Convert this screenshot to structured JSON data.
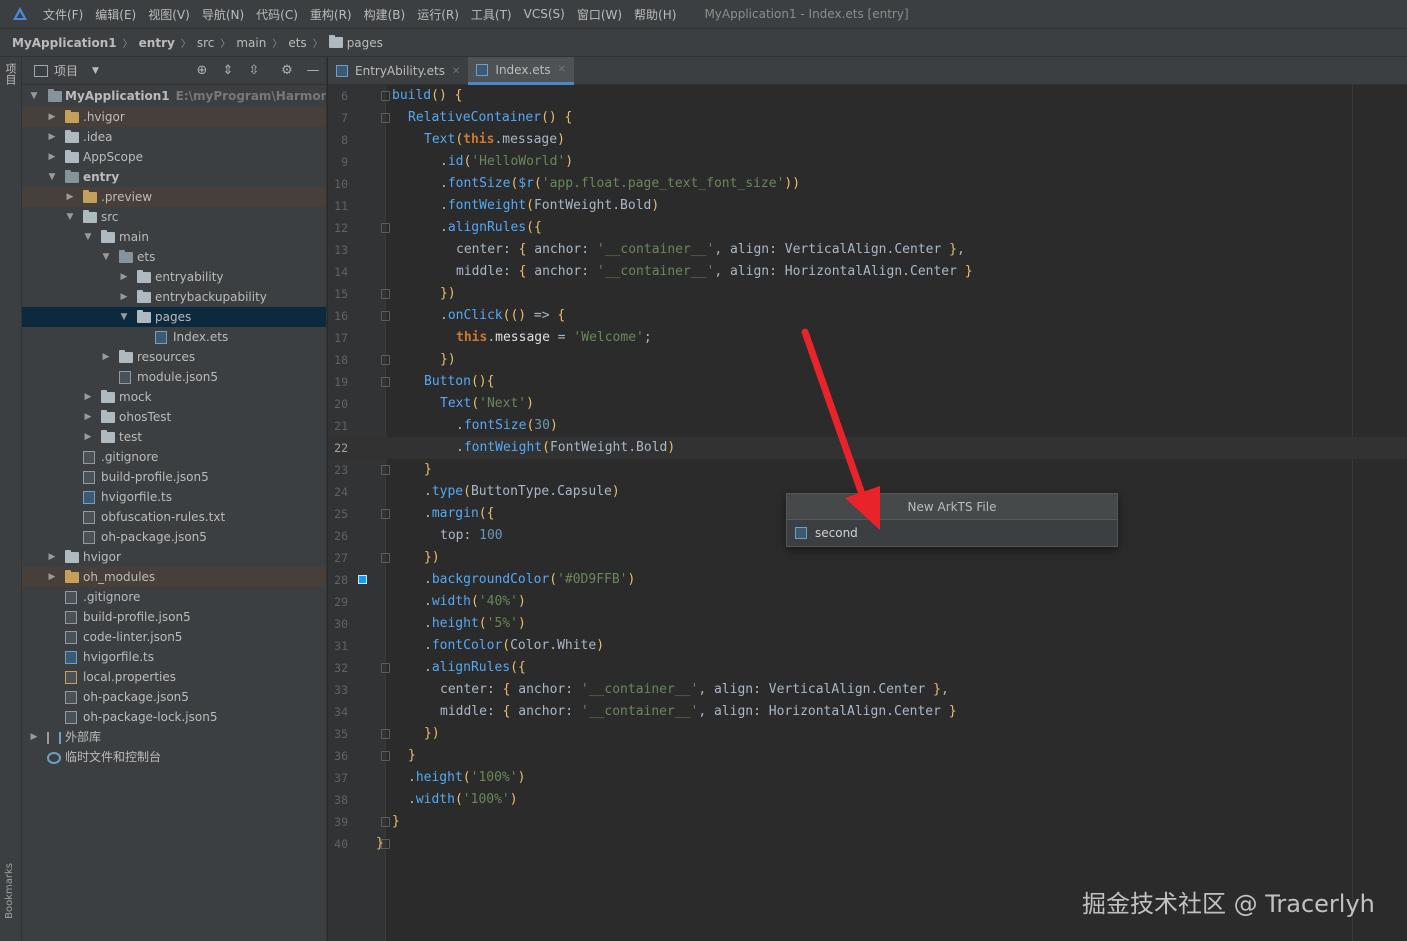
{
  "menubar": {
    "items": [
      "文件(F)",
      "编辑(E)",
      "视图(V)",
      "导航(N)",
      "代码(C)",
      "重构(R)",
      "构建(B)",
      "运行(R)",
      "工具(T)",
      "VCS(S)",
      "窗口(W)",
      "帮助(H)"
    ],
    "window_title": "MyApplication1 - Index.ets [entry]"
  },
  "breadcrumb": {
    "project": "MyApplication1",
    "module": "entry",
    "parts": [
      "src",
      "main",
      "ets"
    ],
    "current": "pages"
  },
  "left_strip": {
    "project_label": "项目",
    "bookmarks_label": "Bookmarks"
  },
  "project_panel": {
    "title": "项目",
    "root_label": "MyApplication1",
    "root_path": "E:\\myProgram\\HarmonyOS",
    "tree": [
      {
        "label": ".hvigor"
      },
      {
        "label": ".idea"
      },
      {
        "label": "AppScope"
      },
      {
        "label": "entry"
      },
      {
        "label": ".preview"
      },
      {
        "label": "src"
      },
      {
        "label": "main"
      },
      {
        "label": "ets"
      },
      {
        "label": "entryability"
      },
      {
        "label": "entrybackupability"
      },
      {
        "label": "pages"
      },
      {
        "label": "Index.ets"
      },
      {
        "label": "resources"
      },
      {
        "label": "module.json5"
      },
      {
        "label": "mock"
      },
      {
        "label": "ohosTest"
      },
      {
        "label": "test"
      },
      {
        "label": ".gitignore"
      },
      {
        "label": "build-profile.json5"
      },
      {
        "label": "hvigorfile.ts"
      },
      {
        "label": "obfuscation-rules.txt"
      },
      {
        "label": "oh-package.json5"
      },
      {
        "label": "hvigor"
      },
      {
        "label": "oh_modules"
      },
      {
        "label": ".gitignore"
      },
      {
        "label": "build-profile.json5"
      },
      {
        "label": "code-linter.json5"
      },
      {
        "label": "hvigorfile.ts"
      },
      {
        "label": "local.properties"
      },
      {
        "label": "oh-package.json5"
      },
      {
        "label": "oh-package-lock.json5"
      },
      {
        "label": "外部库"
      },
      {
        "label": "临时文件和控制台"
      }
    ]
  },
  "tabs": [
    {
      "label": "EntryAbility.ets",
      "active": false
    },
    {
      "label": "Index.ets",
      "active": true
    }
  ],
  "editor": {
    "lines": [
      {
        "n": "6",
        "text": "build() {"
      },
      {
        "n": "7",
        "text": "RelativeContainer() {"
      },
      {
        "n": "8",
        "text": "Text(this.message)"
      },
      {
        "n": "9",
        "text": ".id('HelloWorld')"
      },
      {
        "n": "10",
        "text": ".fontSize($r('app.float.page_text_font_size'))"
      },
      {
        "n": "11",
        "text": ".fontWeight(FontWeight.Bold)"
      },
      {
        "n": "12",
        "text": ".alignRules({"
      },
      {
        "n": "13",
        "text": "center: { anchor: '__container__', align: VerticalAlign.Center },"
      },
      {
        "n": "14",
        "text": "middle: { anchor: '__container__', align: HorizontalAlign.Center }"
      },
      {
        "n": "15",
        "text": "})"
      },
      {
        "n": "16",
        "text": ".onClick(() => {"
      },
      {
        "n": "17",
        "text": "this.message = 'Welcome';"
      },
      {
        "n": "18",
        "text": "})"
      },
      {
        "n": "19",
        "text": "Button(){"
      },
      {
        "n": "20",
        "text": "Text('Next')"
      },
      {
        "n": "21",
        "text": ".fontSize(30)"
      },
      {
        "n": "22",
        "text": ".fontWeight(FontWeight.Bold)"
      },
      {
        "n": "23",
        "text": "}"
      },
      {
        "n": "24",
        "text": ".type(ButtonType.Capsule)"
      },
      {
        "n": "25",
        "text": ".margin({"
      },
      {
        "n": "26",
        "text": "top: 100"
      },
      {
        "n": "27",
        "text": "})"
      },
      {
        "n": "28",
        "text": ".backgroundColor('#0D9FFB')"
      },
      {
        "n": "29",
        "text": ".width('40%')"
      },
      {
        "n": "30",
        "text": ".height('5%')"
      },
      {
        "n": "31",
        "text": ".fontColor(Color.White)"
      },
      {
        "n": "32",
        "text": ".alignRules({"
      },
      {
        "n": "33",
        "text": "center: { anchor: '__container__', align: VerticalAlign.Center },"
      },
      {
        "n": "34",
        "text": "middle: { anchor: '__container__', align: HorizontalAlign.Center }"
      },
      {
        "n": "35",
        "text": "})"
      },
      {
        "n": "36",
        "text": "}"
      },
      {
        "n": "37",
        "text": ".height('100%')"
      },
      {
        "n": "38",
        "text": ".width('100%')"
      },
      {
        "n": "39",
        "text": "}"
      },
      {
        "n": "40",
        "text": "}"
      }
    ],
    "current_line": "22"
  },
  "popup": {
    "title": "New ArkTS File",
    "input_value": "second"
  },
  "watermark": "掘金技术社区 @ Tracerlyh",
  "colors": {
    "accent": "#4a88c7",
    "annotation_arrow": "#e8232a",
    "swatch": "#0D9FFB"
  }
}
